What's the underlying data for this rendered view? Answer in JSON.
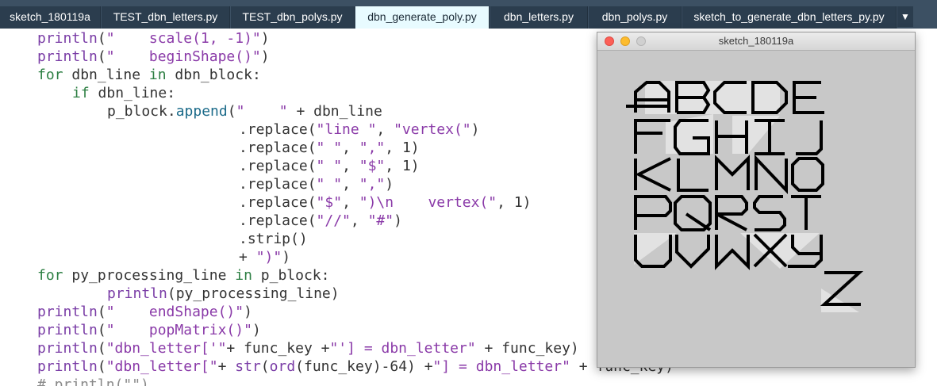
{
  "tabs": [
    {
      "label": "sketch_180119a",
      "active": false
    },
    {
      "label": "TEST_dbn_letters.py",
      "active": false
    },
    {
      "label": "TEST_dbn_polys.py",
      "active": false
    },
    {
      "label": "dbn_generate_poly.py",
      "active": true
    },
    {
      "label": "dbn_letters.py",
      "active": false
    },
    {
      "label": "dbn_polys.py",
      "active": false
    },
    {
      "label": "sketch_to_generate_dbn_letters_py.py",
      "active": false
    }
  ],
  "tab_more_glyph": "▼",
  "code": {
    "l1": {
      "a": "println",
      "b": "(",
      "c": "\"    scale(1, -1)\"",
      "d": ")"
    },
    "l2": {
      "a": "println",
      "b": "(",
      "c": "\"    beginShape()\"",
      "d": ")"
    },
    "l3": {
      "a": "for",
      "b": " dbn_line ",
      "c": "in",
      "d": " dbn_block:"
    },
    "l4": {
      "a": "if",
      "b": " dbn_line:"
    },
    "l5": {
      "a": "p_block.",
      "b": "append",
      "c": "(",
      "d": "\"    \"",
      "e": " + dbn_line"
    },
    "l6": {
      "a": ".replace(",
      "b": "\"line \"",
      "c": ", ",
      "d": "\"vertex(\"",
      "e": ")"
    },
    "l7": {
      "a": ".replace(",
      "b": "\" \"",
      "c": ", ",
      "d": "\",\"",
      "e": ", 1)"
    },
    "l8": {
      "a": ".replace(",
      "b": "\" \"",
      "c": ", ",
      "d": "\"$\"",
      "e": ", 1)"
    },
    "l9": {
      "a": ".replace(",
      "b": "\" \"",
      "c": ", ",
      "d": "\",\"",
      "e": ")"
    },
    "l10": {
      "a": ".replace(",
      "b": "\"$\"",
      "c": ", ",
      "d": "\")\\n    vertex(\"",
      "e": ", 1)"
    },
    "l11": {
      "a": ".replace(",
      "b": "\"//\"",
      "c": ", ",
      "d": "\"#\"",
      "e": ")"
    },
    "l12": {
      "a": ".strip()"
    },
    "l13": {
      "a": "+ ",
      "b": "\")\"",
      "c": ")"
    },
    "l14": {
      "a": "for",
      "b": " py_processing_line ",
      "c": "in",
      "d": " p_block:"
    },
    "l15": {
      "a": "println",
      "b": "(py_processing_line)"
    },
    "l16": {
      "a": "println",
      "b": "(",
      "c": "\"    endShape()\"",
      "d": ")"
    },
    "l17": {
      "a": "println",
      "b": "(",
      "c": "\"    popMatrix()\"",
      "d": ")"
    },
    "l18": {
      "a": "println",
      "b": "(",
      "c": "\"dbn_letter['\"",
      "d": "+ func_key +",
      "e": "\"'] = dbn_letter\"",
      "f": " + func_key)"
    },
    "l19": {
      "a": "println",
      "b": "(",
      "c": "\"dbn_letter[\"",
      "d": "+ ",
      "e": "str",
      "f": "(",
      "g": "ord",
      "h": "(func_key)-64) +",
      "i": "\"] = dbn_letter\"",
      "j": " + func_key)"
    },
    "l20": {
      "a": "# println(\"\")"
    }
  },
  "sketch_window": {
    "title": "sketch_180119a",
    "background": "#c8c8c8",
    "glyph_color": "#000000",
    "shadow_color": "#e2e2e2",
    "letter_rows": [
      "ABCDE",
      "FGHIJ",
      "KLMNO",
      "PQRST",
      "UVWXY",
      "Z"
    ]
  },
  "colors": {
    "tabbar": "#3c5063",
    "tab": "#2b3d4e",
    "tab_active": "#e8fbff",
    "keyword": "#2d7f43",
    "function": "#1c6b8a",
    "string": "#8a3aa8",
    "traffic_red": "#fc5f57",
    "traffic_yellow": "#fdbc2e",
    "traffic_gray": "#d0d0d0"
  }
}
